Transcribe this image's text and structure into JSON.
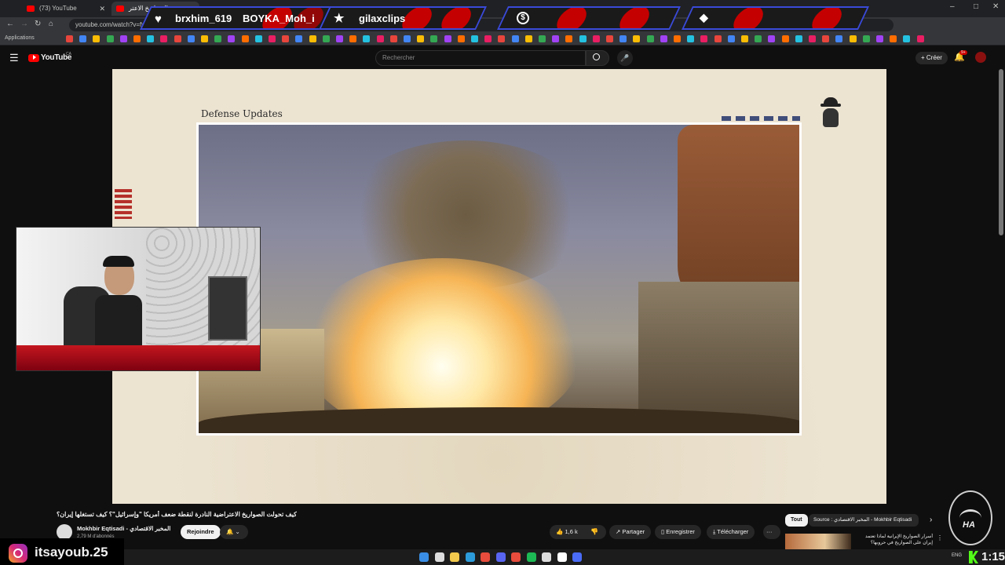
{
  "browser": {
    "tabs": [
      {
        "label": "(73) YouTube",
        "active": false
      },
      {
        "label": "الصواريخ الاعتر",
        "active": true
      }
    ],
    "new_tab": "+",
    "url": "youtube.com/watch?v=fva",
    "bookmarks_label": "Applications",
    "window_controls": [
      "–",
      "□",
      "✕"
    ]
  },
  "stream_overlay": {
    "segments": [
      {
        "icon": "heart-icon",
        "text": "brxhim_619"
      },
      {
        "icon": "",
        "text": "BOYKA_Moh_i"
      },
      {
        "icon": "star-icon",
        "text": "gilaxclips"
      },
      {
        "icon": "dollar-icon",
        "text": ""
      },
      {
        "icon": "diamond-icon",
        "text": ""
      }
    ]
  },
  "youtube": {
    "logo": "YouTube",
    "region": "CA",
    "search_placeholder": "Rechercher",
    "create_label": "Créer",
    "notif_badge": "9+"
  },
  "video_overlay": {
    "heading": "Defense Updates"
  },
  "video_info": {
    "title": "كيف تحولت الصواريخ الاعتراضية النادرة لنقطة ضعف أمريكا \"وإسرائيل\"؟ كيف تستغلها إيران؟",
    "channel": "Mokhbir Eqtisadi - المخبر الاقتصادي",
    "subscribers": "2,79 M d'abonnés",
    "join_label": "Rejoindre",
    "likes": "1,6 k",
    "share_label": "Partager",
    "save_label": "Enregistrer",
    "download_label": "Télécharger",
    "more_label": "···"
  },
  "side_panel": {
    "chip_all": "Tout",
    "chip_source": "Source : المخبر الاقتصادي - Mokhbir Eqtisadi",
    "rec_title": "أسرار الصواريخ الإيرانية لماذا تعتمد إيران على الصواريخ في حروبها؟"
  },
  "streamer": {
    "instagram": "itsayoub.25",
    "clock": "1:15",
    "lang": "ENG"
  },
  "colors": {
    "youtube_red": "#ff0000",
    "overlay_border": "#3a4ad8",
    "overlay_red": "#c50000",
    "paper": "#ece3d1"
  }
}
